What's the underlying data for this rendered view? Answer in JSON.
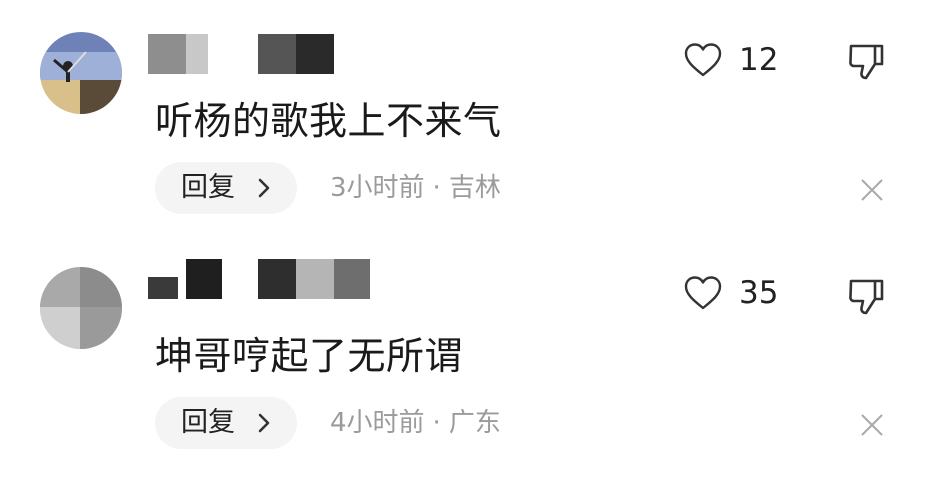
{
  "comments": [
    {
      "text": "听杨的歌我上不来气",
      "reply_label": "回复",
      "time": "3小时前",
      "separator": "·",
      "location": "吉林",
      "likes": "12"
    },
    {
      "text": "坤哥哼起了无所谓",
      "reply_label": "回复",
      "time": "4小时前",
      "separator": "·",
      "location": "广东",
      "likes": "35"
    }
  ],
  "icons": {
    "like": "heart-outline-icon",
    "dislike": "thumbs-down-icon",
    "reply_arrow": "chevron-right-icon",
    "dismiss": "close-icon"
  },
  "colors": {
    "text": "#1a1a1a",
    "meta": "#9b9b9b",
    "reply_bg": "#f4f4f4",
    "icon": "#333333"
  }
}
